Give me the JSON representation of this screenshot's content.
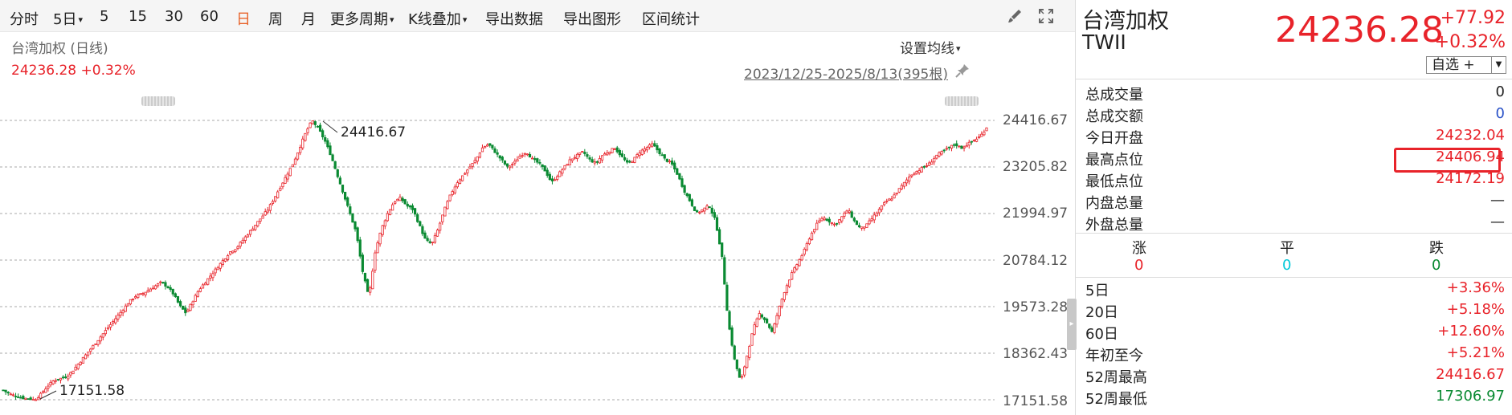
{
  "toolbar": {
    "items": [
      "分时",
      "5日",
      "5",
      "15",
      "30",
      "60",
      "日",
      "周",
      "月",
      "更多周期",
      "K线叠加",
      "导出数据",
      "导出图形",
      "区间统计"
    ]
  },
  "chart_header": {
    "title": "台湾加权 (日线)",
    "price": "24236.28",
    "pct": "+0.32%",
    "ma_setting": "设置均线",
    "date_range": "2023/12/25-2025/8/13(395根)"
  },
  "chart_data": {
    "type": "candlestick",
    "y_ticks": [
      "24416.67",
      "23205.82",
      "21994.97",
      "20784.12",
      "19573.28",
      "18362.43",
      "17151.58"
    ],
    "ylim": [
      17151.58,
      24416.67
    ],
    "high_annotation": "24416.67",
    "low_annotation": "17151.58",
    "closes": [
      17400,
      17300,
      17250,
      17200,
      17180,
      17151.58,
      17300,
      17500,
      17650,
      17700,
      17750,
      17900,
      18100,
      18300,
      18500,
      18700,
      18900,
      19100,
      19300,
      19500,
      19700,
      19850,
      19900,
      20000,
      20100,
      20200,
      20100,
      19900,
      19600,
      19400,
      19700,
      20000,
      20200,
      20400,
      20600,
      20800,
      21000,
      21100,
      21300,
      21500,
      21700,
      21900,
      22100,
      22400,
      22700,
      23000,
      23300,
      23700,
      24100,
      24416.67,
      24200,
      23900,
      23500,
      23000,
      22500,
      22000,
      21500,
      20500,
      19800,
      21000,
      21600,
      22000,
      22300,
      22400,
      22200,
      22100,
      21700,
      21300,
      21200,
      21600,
      22100,
      22500,
      22800,
      23000,
      23200,
      23400,
      23700,
      23800,
      23600,
      23400,
      23200,
      23300,
      23500,
      23600,
      23400,
      23300,
      23100,
      22800,
      23000,
      23200,
      23400,
      23500,
      23600,
      23400,
      23300,
      23500,
      23600,
      23700,
      23500,
      23300,
      23400,
      23600,
      23700,
      23800,
      23600,
      23400,
      23300,
      23000,
      22600,
      22300,
      22000,
      22100,
      22200,
      21800,
      20900,
      19200,
      18200,
      17600,
      18300,
      19000,
      19400,
      19200,
      18900,
      19500,
      20000,
      20400,
      20700,
      21000,
      21400,
      21700,
      21900,
      21800,
      21700,
      21900,
      22100,
      21800,
      21600,
      21700,
      21900,
      22100,
      22300,
      22400,
      22600,
      22800,
      23000,
      23100,
      23200,
      23300,
      23500,
      23600,
      23700,
      23800,
      23700,
      23800,
      23900,
      24000,
      24236.28
    ]
  },
  "quote": {
    "name": "台湾加权",
    "code": "TWII",
    "price": "24236.28",
    "change": "+77.92",
    "pct": "+0.32%",
    "fav_label": "自选 +"
  },
  "stats": [
    {
      "label": "总成交量",
      "value": "0",
      "color": "#222222"
    },
    {
      "label": "总成交额",
      "value": "0",
      "color": "#2a52c8"
    },
    {
      "label": "今日开盘",
      "value": "24232.04",
      "color": "#e8232a"
    },
    {
      "label": "最高点位",
      "value": "24406.94",
      "color": "#e8232a"
    },
    {
      "label": "最低点位",
      "value": "24172.19",
      "color": "#e8232a"
    },
    {
      "label": "内盘总量",
      "value": "—",
      "color": "#222222"
    },
    {
      "label": "外盘总量",
      "value": "—",
      "color": "#222222"
    }
  ],
  "breadth": {
    "up_label": "涨",
    "up_value": "0",
    "flat_label": "平",
    "flat_value": "0",
    "down_label": "跌",
    "down_value": "0"
  },
  "returns": [
    {
      "label": "5日",
      "value": "+3.36%",
      "color": "#e8232a"
    },
    {
      "label": "20日",
      "value": "+5.18%",
      "color": "#e8232a"
    },
    {
      "label": "60日",
      "value": "+12.60%",
      "color": "#e8232a"
    },
    {
      "label": "年初至今",
      "value": "+5.21%",
      "color": "#e8232a"
    },
    {
      "label": "52周最高",
      "value": "24416.67",
      "color": "#e8232a"
    },
    {
      "label": "52周最低",
      "value": "17306.97",
      "color": "#0a8a32"
    }
  ]
}
